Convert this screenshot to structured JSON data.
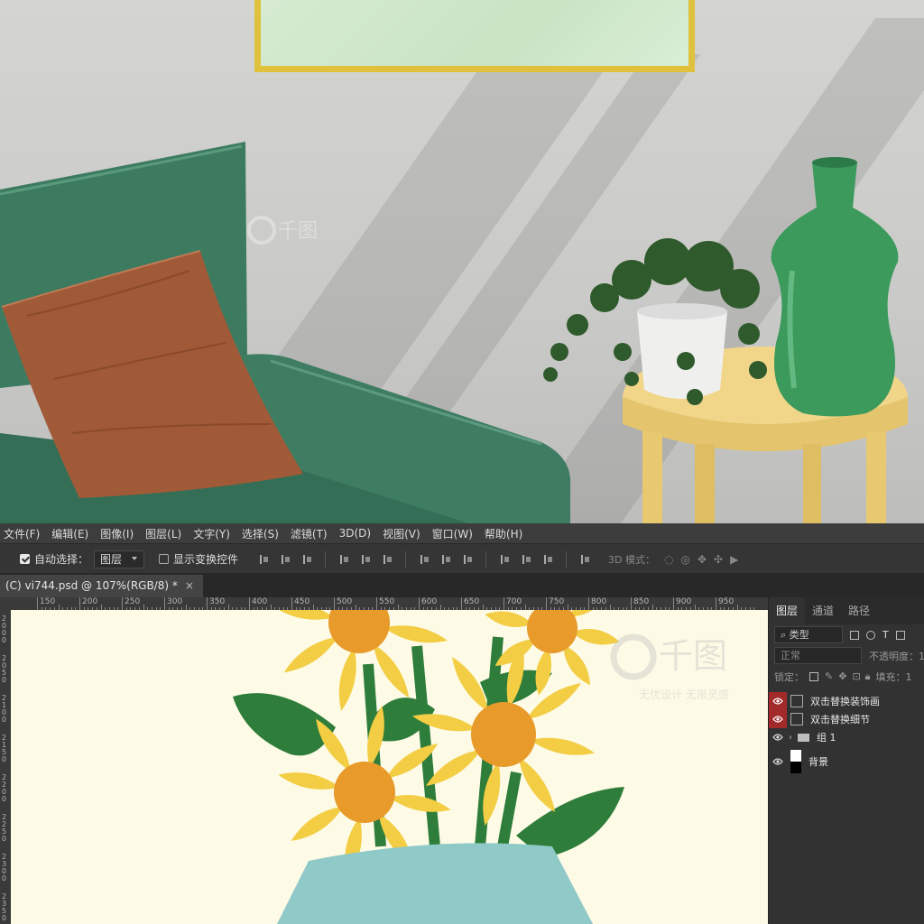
{
  "menu": [
    "文件(F)",
    "编辑(E)",
    "图像(I)",
    "图层(L)",
    "文字(Y)",
    "选择(S)",
    "滤镜(T)",
    "3D(D)",
    "视图(V)",
    "窗口(W)",
    "帮助(H)"
  ],
  "options": {
    "auto_select_label": "自动选择：",
    "auto_select_checked": true,
    "auto_select_target": "图层",
    "show_transform_label": "显示变换控件",
    "show_transform_checked": false,
    "mode_3d_label": "3D 模式："
  },
  "document_tab": {
    "title": "(C) vi744.psd @ 107%(RGB/8) *",
    "close": "×"
  },
  "ruler": {
    "h_labels": [
      "150",
      "200",
      "250",
      "300",
      "350",
      "400",
      "450",
      "500",
      "550",
      "600",
      "650",
      "700",
      "750",
      "800",
      "850",
      "900",
      "950"
    ],
    "v_labels": [
      "2000",
      "2050",
      "2100",
      "2150",
      "2200",
      "2250",
      "2300",
      "2350"
    ]
  },
  "panel": {
    "tabs": [
      "图层",
      "通道",
      "路径"
    ],
    "active_tab": "图层",
    "filter_kind": "类型",
    "blend_mode": "正常",
    "opacity_label": "不透明度：1",
    "lock_label": "锁定：",
    "fill_label": "填充：1",
    "layers": [
      {
        "name": "双击替换装饰画",
        "type": "smart",
        "highlight": true
      },
      {
        "name": "双击替换细节",
        "type": "smart",
        "highlight": true
      },
      {
        "name": "组 1",
        "type": "group",
        "highlight": false
      },
      {
        "name": "背景",
        "type": "background",
        "highlight": false
      }
    ]
  },
  "watermark": {
    "logo": "千图",
    "sub": "无忧设计 无限灵感"
  },
  "colors": {
    "canvas_bg": "#fdfbe6",
    "petal": "#f3cd43",
    "flower_center": "#e89a2b",
    "leaf": "#2f7d3a",
    "vase": "#8fc9c8",
    "sofa": "#3f7d63",
    "pillow": "#a15a37",
    "frame": "#e0c13c",
    "highlight_red": "#a22a2a"
  }
}
